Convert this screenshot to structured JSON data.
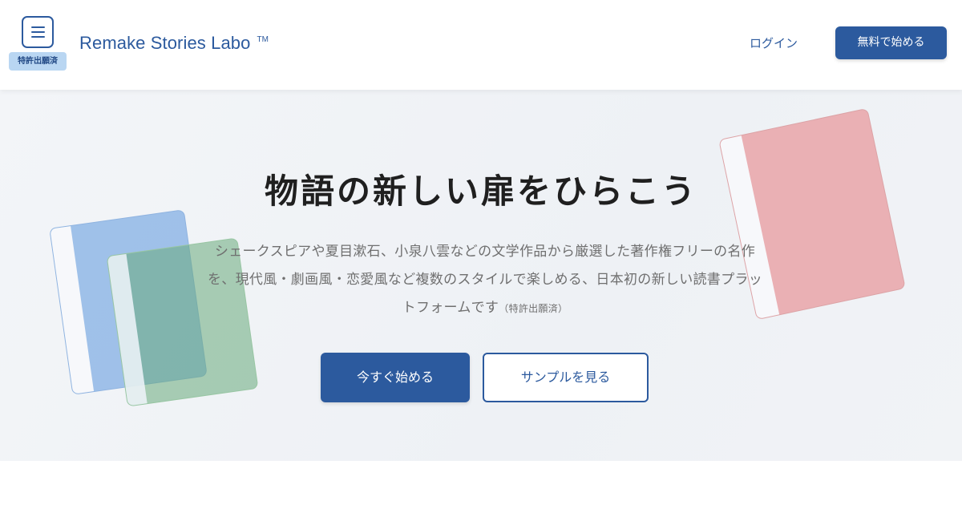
{
  "header": {
    "patent_badge": "特許出願済",
    "brand_name": "Remake Stories Labo",
    "trademark": "TM",
    "login_label": "ログイン",
    "start_free_label": "無料で始める"
  },
  "hero": {
    "title": "物語の新しい扉をひらこう",
    "description": "シェークスピアや夏目漱石、小泉八雲などの文学作品から厳選した著作権フリーの名作を、現代風・劇画風・恋愛風など複数のスタイルで楽しめる、日本初の新しい読書プラットフォームです",
    "description_note": "（特許出願済）",
    "primary_button": "今すぐ始める",
    "secondary_button": "サンプルを見る"
  },
  "colors": {
    "brand": "#2c5a9e",
    "badge_bg": "#b9d6f2",
    "book_blue": "#78a8e2",
    "book_green": "#68aa7c",
    "book_red": "#e89ea2"
  },
  "icons": [
    "menu-icon"
  ]
}
